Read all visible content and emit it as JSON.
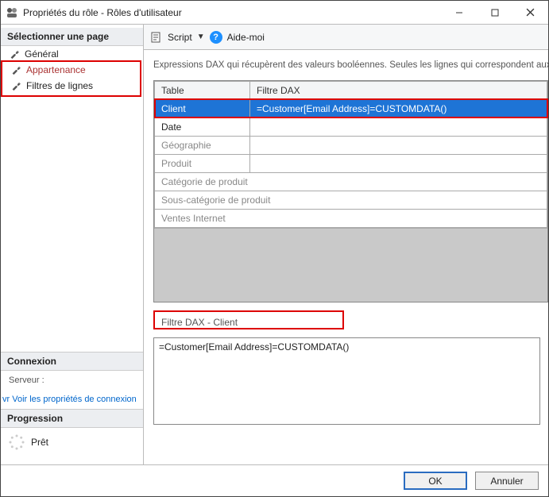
{
  "window": {
    "title": "Propriétés du rôle -   Rôles d'utilisateur"
  },
  "sidebar": {
    "select_page_header": "Sélectionner une page",
    "items": [
      {
        "label": "Général"
      },
      {
        "label": "Appartenance"
      },
      {
        "label": "Filtres de lignes"
      }
    ],
    "connection_header": "Connexion",
    "server_label": "Serveur :",
    "view_props_link": "vr Voir les propriétés de connexion",
    "progress_header": "Progression",
    "progress_status": "Prêt"
  },
  "toolbar": {
    "script_label": "Script",
    "help_label": "Aide-moi"
  },
  "description": "Expressions DAX qui récupèrent des valeurs booléennes. Seules les lignes qui correspondent aux filtres spécifiés sont visibles pour les utilisateurs de ce rôle.",
  "grid": {
    "columns": {
      "table": "Table",
      "filter": "Filtre DAX"
    },
    "rows": [
      {
        "table": "Client",
        "filter": "=Customer[Email Address]=CUSTOMDATA()",
        "selected": true
      },
      {
        "table": "Date",
        "filter": ""
      },
      {
        "table": "Géographie",
        "filter": ""
      },
      {
        "table": "Produit",
        "filter": ""
      },
      {
        "table": "Catégorie de produit",
        "filter": ""
      },
      {
        "table": "Sous-catégorie de produit",
        "filter": ""
      },
      {
        "table": "Ventes Internet",
        "filter": ""
      }
    ]
  },
  "dax_section": {
    "label_prefix": "Filtre DAX - ",
    "current_table": "Client",
    "expression": "=Customer[Email Address]=CUSTOMDATA()"
  },
  "footer": {
    "ok_label": "OK",
    "cancel_label": "Annuler"
  }
}
